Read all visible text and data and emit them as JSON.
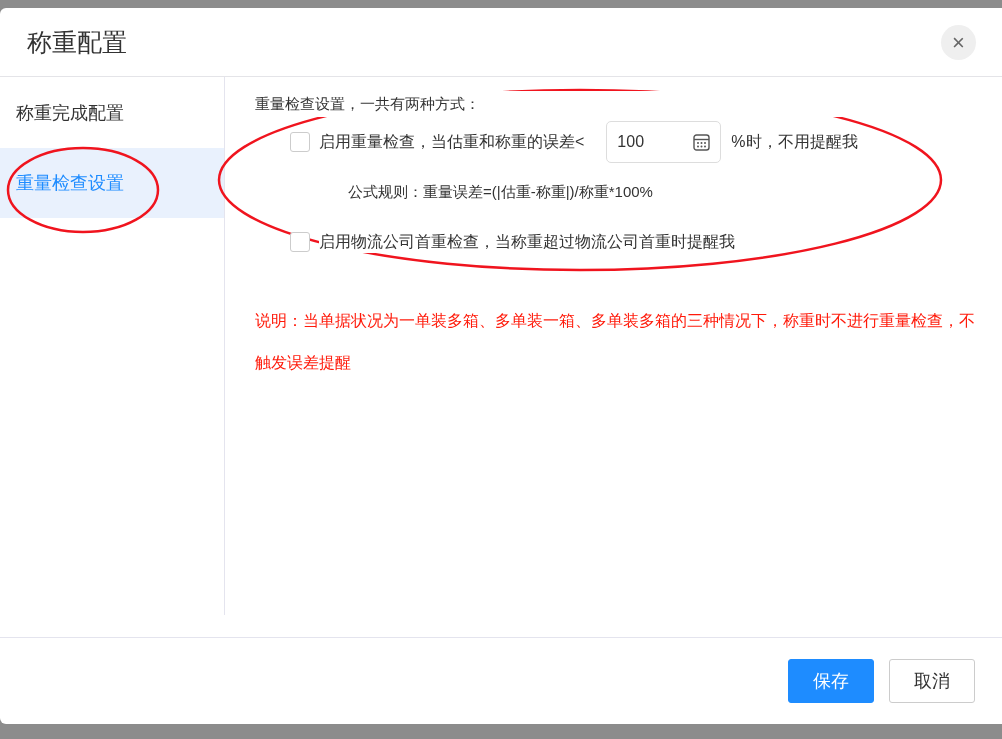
{
  "dialog": {
    "title": "称重配置",
    "close": "×"
  },
  "sidebar": {
    "items": [
      {
        "label": "称重完成配置",
        "selected": false
      },
      {
        "label": "重量检查设置",
        "selected": true
      }
    ]
  },
  "content": {
    "heading": "重量检查设置，一共有两种方式：",
    "options": [
      {
        "kind": "threshold",
        "label": "启用重量检查，当估重和称重的误差<",
        "checked": false,
        "value": "100",
        "suffix": "%时，不用提醒我",
        "formula": "公式规则：重量误差=(|估重-称重|)/称重*100%"
      },
      {
        "kind": "plain",
        "label": "启用物流公司首重检查，当称重超过物流公司首重时提醒我",
        "checked": false
      }
    ],
    "note": "说明：当单据状况为一单装多箱、多单装一箱、多单装多箱的三种情况下，称重时不进行重量检查，不触发误差提醒"
  },
  "footer": {
    "buttons": [
      {
        "label": "保存",
        "kind": "primary"
      },
      {
        "label": "取消",
        "kind": "default"
      }
    ]
  }
}
